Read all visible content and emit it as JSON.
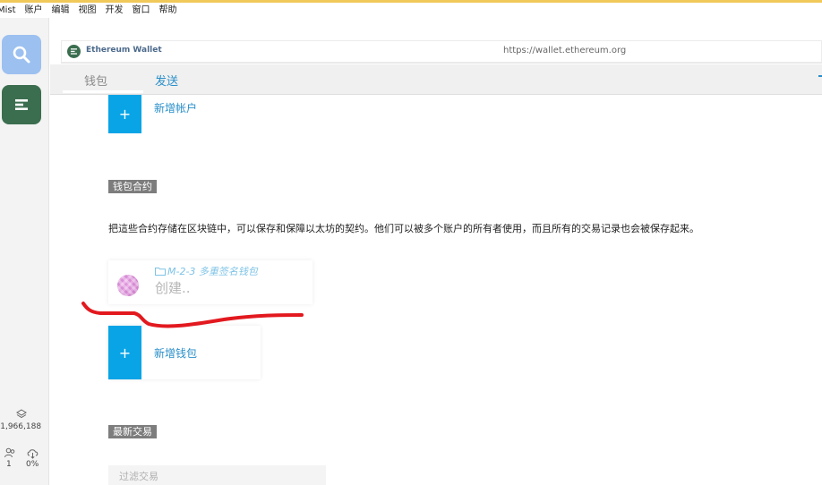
{
  "menu": [
    "Mist",
    "账户",
    "编辑",
    "视图",
    "开发",
    "窗口",
    "帮助"
  ],
  "rail": {
    "block_number": "-1,966,188",
    "peers": "1",
    "sync": "0%"
  },
  "url_bar": {
    "site_name": "Ethereum Wallet",
    "url": "https://wallet.ethereum.org"
  },
  "tabs": {
    "wallet": "钱包",
    "send": "发送"
  },
  "accounts": {
    "add_label": "新增帐户",
    "plus": "+"
  },
  "contracts": {
    "heading": "钱包合约",
    "description": "把這些合约存储在区块链中，可以保存和保障以太坊的契约。他们可以被多个账户的所有者使用，而且所有的交易记录也会被保存起来。",
    "card": {
      "title": "M-2-3 多重签名钱包",
      "status": "创建.."
    },
    "add_label": "新增钱包",
    "plus": "+"
  },
  "transactions": {
    "heading": "最新交易",
    "filter_placeholder": "过滤交易"
  },
  "colors": {
    "accent_blue": "#08a4e6",
    "link_blue": "#2a8fc9",
    "wallet_green": "#3b6e4f",
    "annotation_red": "#e2191f"
  }
}
